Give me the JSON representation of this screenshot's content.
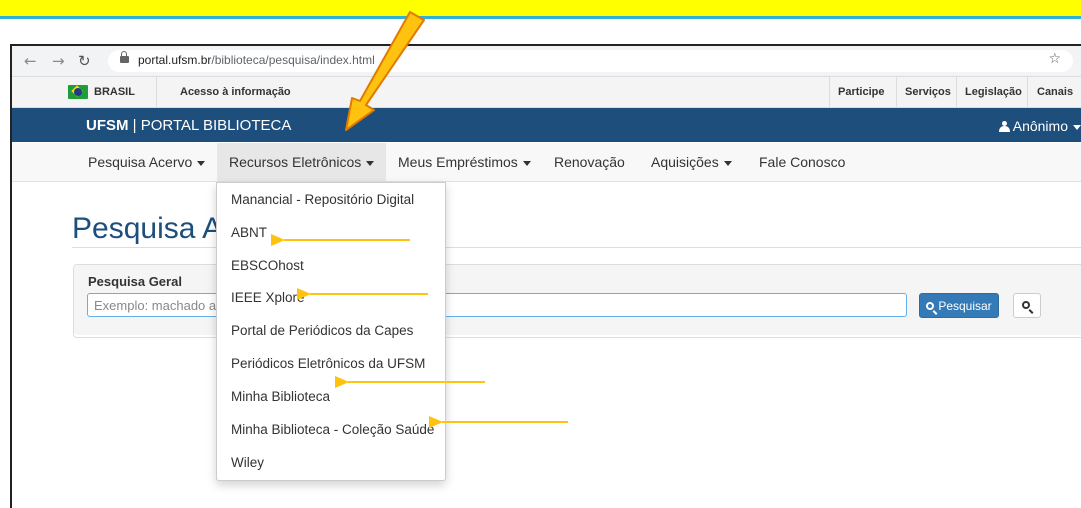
{
  "browser": {
    "url_host": "portal.ufsm.br",
    "url_path": "/biblioteca/pesquisa/index.html"
  },
  "govbar": {
    "country": "BRASIL",
    "access": "Acesso à informação",
    "links": [
      "Participe",
      "Serviços",
      "Legislação",
      "Canais"
    ]
  },
  "header": {
    "brand_strong": "UFSM",
    "brand_sep": " | ",
    "brand_rest": "PORTAL BIBLIOTECA",
    "user": "Anônimo"
  },
  "nav": {
    "items": [
      {
        "label": "Pesquisa Acervo",
        "dropdown": true
      },
      {
        "label": "Recursos Eletrônicos",
        "dropdown": true
      },
      {
        "label": "Meus Empréstimos",
        "dropdown": true
      },
      {
        "label": "Renovação",
        "dropdown": false
      },
      {
        "label": "Aquisições",
        "dropdown": true
      },
      {
        "label": "Fale Conosco",
        "dropdown": false
      }
    ]
  },
  "dropdown_items": [
    "Manancial - Repositório Digital",
    "ABNT",
    "EBSCOhost",
    "IEEE Xplore",
    "Portal de Periódicos da Capes",
    "Periódicos Eletrônicos da UFSM",
    "Minha Biblioteca",
    "Minha Biblioteca - Coleção Saúde",
    "Wiley"
  ],
  "page": {
    "title": "Pesquisa Ac",
    "panel_label": "Pesquisa Geral",
    "search_placeholder": "Exemplo: machado a",
    "search_button": "Pesquisar"
  },
  "colors": {
    "header_bg": "#1d4e7c",
    "primary_button": "#337ab7",
    "annotation_arrow": "#ffc20e",
    "top_band": "#ffff00"
  }
}
